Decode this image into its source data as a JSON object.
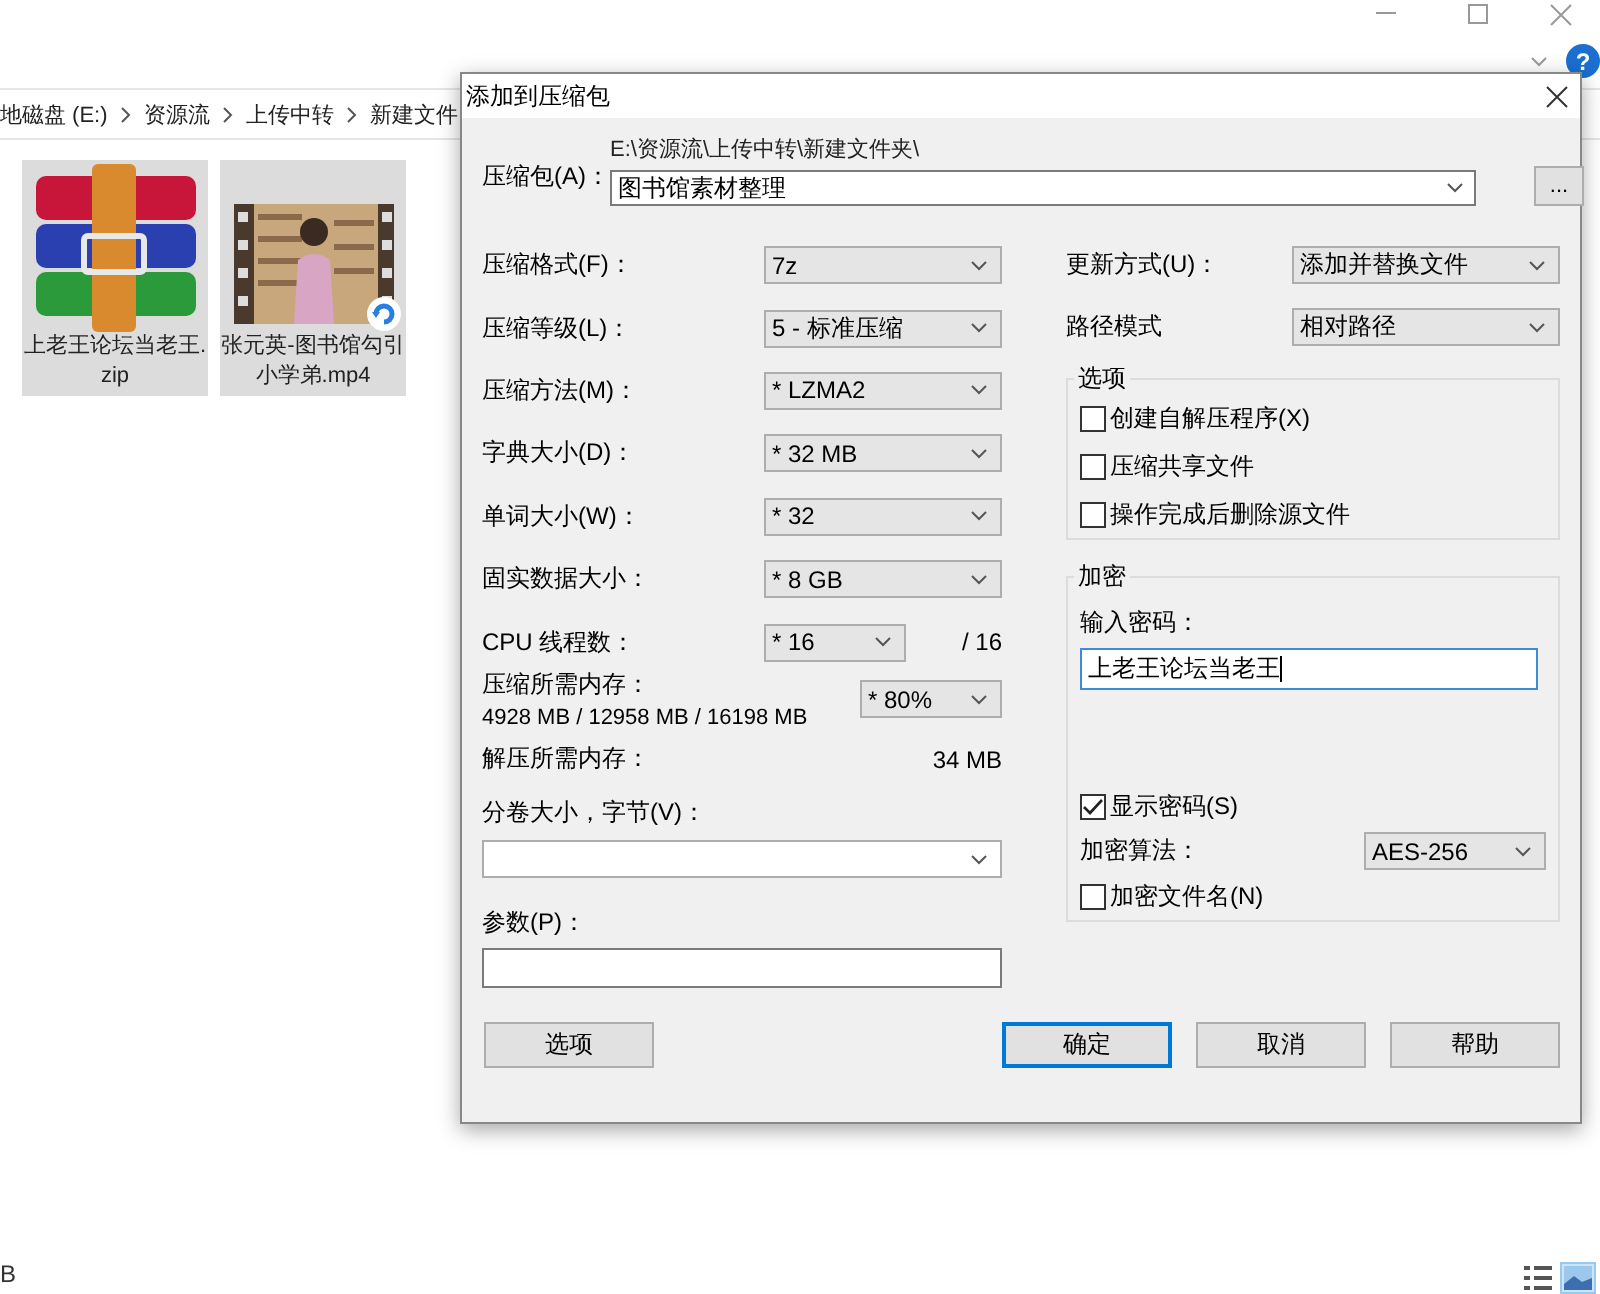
{
  "explorer": {
    "help_button": "?",
    "breadcrumb": [
      "地磁盘 (E:)",
      "资源流",
      "上传中转",
      "新建文件"
    ],
    "files": [
      {
        "name": "上老王论坛当老王.zip",
        "kind": "archive",
        "selected": true
      },
      {
        "name": "张元英-图书馆勾引小学弟.mp4",
        "kind": "video",
        "selected": true
      }
    ],
    "status_bar": {
      "text": "B"
    },
    "view_buttons": [
      {
        "kind": "details",
        "selected": false
      },
      {
        "kind": "thumbnails",
        "selected": true
      }
    ]
  },
  "dialog": {
    "title": "添加到压缩包",
    "archive": {
      "label": "压缩包(A)：",
      "path": "E:\\资源流\\上传中转\\新建文件夹\\",
      "value": "图书馆素材整理",
      "browse": "..."
    },
    "settings": [
      {
        "label": "压缩格式(F)：",
        "value": "7z"
      },
      {
        "label": "压缩等级(L)：",
        "value": "5 - 标准压缩"
      },
      {
        "label": "压缩方法(M)：",
        "value": "* LZMA2"
      },
      {
        "label": "字典大小(D)：",
        "value": "* 32 MB"
      },
      {
        "label": "单词大小(W)：",
        "value": "* 32"
      },
      {
        "label": "固实数据大小：",
        "value": "* 8 GB"
      }
    ],
    "threads": {
      "label": "CPU 线程数：",
      "value": "* 16",
      "total": "/ 16"
    },
    "memory": {
      "label": "压缩所需内存：",
      "detail": "4928 MB / 12958 MB / 16198 MB",
      "value": "* 80%"
    },
    "decompress_memory": {
      "label": "解压所需内存：",
      "value": "34 MB"
    },
    "split": {
      "label": "分卷大小，字节(V)："
    },
    "parameters": {
      "label": "参数(P)："
    },
    "options_button": "选项",
    "update": {
      "label": "更新方式(U)：",
      "value": "添加并替换文件"
    },
    "path_mode": {
      "label": "路径模式",
      "value": "相对路径"
    },
    "options_group": {
      "title": "选项",
      "items": [
        {
          "label": "创建自解压程序(X)",
          "checked": false
        },
        {
          "label": "压缩共享文件",
          "checked": false
        },
        {
          "label": "操作完成后删除源文件",
          "checked": false
        }
      ]
    },
    "encryption": {
      "title": "加密",
      "password_label": "输入密码：",
      "password": "上老王论坛当老王",
      "show_password": {
        "label": "显示密码(S)",
        "checked": true
      },
      "method_label": "加密算法：",
      "method": "AES-256",
      "encrypt_names": {
        "label": "加密文件名(N)",
        "checked": false
      }
    },
    "buttons": [
      {
        "label": "确定",
        "default": true
      },
      {
        "label": "取消",
        "default": false
      },
      {
        "label": "帮助",
        "default": false
      }
    ]
  }
}
